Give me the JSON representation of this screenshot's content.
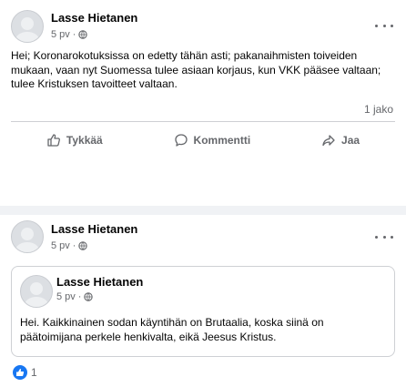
{
  "posts": [
    {
      "author": "Lasse Hietanen",
      "time": "5 pv",
      "separator": "·",
      "privacy_icon": "globe-icon",
      "more_icon": "more-options-icon",
      "text": "Hei; Koronarokotuksissa on edetty tähän asti; pakanaihmisten toiveiden mukaan, vaan nyt Suomessa tulee asiaan korjaus, kun VKK pääsee valtaan; tulee Kristuksen tavoitteet valtaan.",
      "shares": "1 jako",
      "actions": [
        {
          "label": "Tykkää",
          "icon": "like-icon"
        },
        {
          "label": "Kommentti",
          "icon": "comment-icon"
        },
        {
          "label": "Jaa",
          "icon": "share-icon"
        }
      ]
    },
    {
      "author": "Lasse Hietanen",
      "time": "5 pv",
      "separator": "·",
      "privacy_icon": "globe-icon",
      "more_icon": "more-options-icon",
      "shared": {
        "author": "Lasse Hietanen",
        "time": "5 pv",
        "separator": "·",
        "text": "Hei. Kaikkinainen sodan käyntihän on Brutaalia, koska siinä on päätoimijana perkele henkivalta, eikä Jeesus Kristus."
      },
      "reactions": {
        "icon": "like-reaction-icon",
        "count": "1"
      }
    }
  ],
  "colors": {
    "background": "#f0f2f5",
    "card": "#ffffff",
    "text": "#050505",
    "secondary_text": "#65676b",
    "divider": "#ced0d4",
    "brand_blue": "#1877f2"
  }
}
